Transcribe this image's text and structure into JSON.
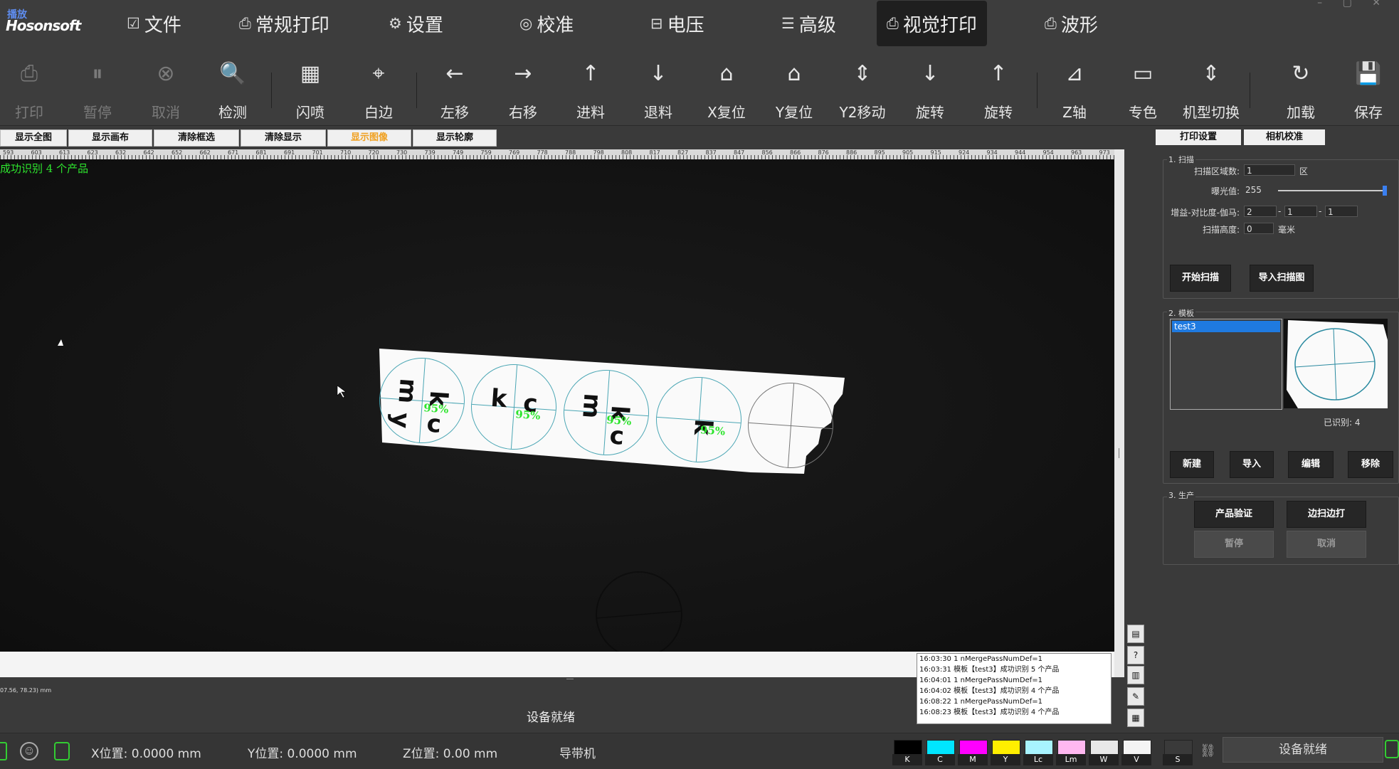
{
  "logo": {
    "top": "播放",
    "brand": "Hosonsoft"
  },
  "menu": [
    {
      "icon": "☑",
      "label": "文件"
    },
    {
      "icon": "⎙",
      "label": "常规打印"
    },
    {
      "icon": "⚙",
      "label": "设置"
    },
    {
      "icon": "◎",
      "label": "校准"
    },
    {
      "icon": "⊟",
      "label": "电压"
    },
    {
      "icon": "☰",
      "label": "高级"
    },
    {
      "icon": "⎙",
      "label": "视觉打印"
    },
    {
      "icon": "⎙",
      "label": "波形"
    }
  ],
  "toolbar": [
    {
      "label": "打印",
      "icon": "⎙",
      "disabled": true
    },
    {
      "label": "暂停",
      "icon": "⏸",
      "disabled": true
    },
    {
      "label": "取消",
      "icon": "⊗",
      "disabled": true
    },
    {
      "label": "检测",
      "icon": "🔍",
      "disabled": false
    },
    {
      "label": "闪喷",
      "icon": "▦",
      "disabled": false
    },
    {
      "label": "白边",
      "icon": "⌖",
      "disabled": false
    },
    {
      "label": "左移",
      "icon": "←",
      "disabled": false
    },
    {
      "label": "右移",
      "icon": "→",
      "disabled": false
    },
    {
      "label": "进料",
      "icon": "↑",
      "disabled": false
    },
    {
      "label": "退料",
      "icon": "↓",
      "disabled": false
    },
    {
      "label": "X复位",
      "icon": "⌂",
      "disabled": false
    },
    {
      "label": "Y复位",
      "icon": "⌂",
      "disabled": false
    },
    {
      "label": "Y2移动",
      "icon": "⇕",
      "disabled": false
    },
    {
      "label": "旋转",
      "icon": "↓",
      "disabled": false
    },
    {
      "label": "旋转",
      "icon": "↑",
      "disabled": false
    },
    {
      "label": "Z轴",
      "icon": "⊿",
      "disabled": false
    },
    {
      "label": "专色",
      "icon": "▭",
      "disabled": false
    },
    {
      "label": "机型切换",
      "icon": "⇕",
      "disabled": false
    },
    {
      "label": "加载",
      "icon": "↻",
      "disabled": false
    },
    {
      "label": "保存",
      "icon": "💾",
      "disabled": false
    }
  ],
  "view_buttons": [
    {
      "label": "显示全图",
      "active": false
    },
    {
      "label": "显示画布",
      "active": false
    },
    {
      "label": "清除框选",
      "active": false
    },
    {
      "label": "清除显示",
      "active": false
    },
    {
      "label": "显示图像",
      "active": true
    },
    {
      "label": "显示轮廓",
      "active": false
    }
  ],
  "ruler_labels": [
    "593",
    "603",
    "613",
    "623",
    "632",
    "642",
    "652",
    "662",
    "671",
    "681",
    "691",
    "701",
    "710",
    "720",
    "730",
    "739",
    "749",
    "759",
    "769",
    "778",
    "788",
    "798",
    "808",
    "817",
    "827",
    "837",
    "847",
    "856",
    "866",
    "876",
    "886",
    "895",
    "905",
    "915",
    "924",
    "934",
    "944",
    "954",
    "963",
    "973"
  ],
  "canvas": {
    "success_text": "成功识别 4 个产品",
    "products": [
      {
        "letters": [
          "m",
          "k",
          "y",
          "c"
        ],
        "percent": "95%"
      },
      {
        "letters": [
          "k",
          "c"
        ],
        "percent": "95%"
      },
      {
        "letters": [
          "m",
          "k",
          "c"
        ],
        "percent": "95%"
      },
      {
        "letters": [
          "k"
        ],
        "percent": "95%"
      },
      {
        "letters": [],
        "percent": ""
      }
    ],
    "coord_text": "07.56, 78.23) mm",
    "status": "设备就绪"
  },
  "right_panel": {
    "tabs": [
      "打印设置",
      "相机校准"
    ],
    "scan": {
      "group_title": "1. 扫描",
      "area_count_label": "扫描区域数:",
      "area_count_value": "1",
      "area_unit": "区",
      "exposure_label": "曝光值:",
      "exposure_value": "255",
      "exposure_level": 1.0,
      "gain_label": "增益-对比度-伽马:",
      "gain_value": "2",
      "contrast_value": "1",
      "gamma_value": "1",
      "height_label": "扫描高度:",
      "height_value": "0",
      "height_unit": "毫米",
      "start_scan": "开始扫描",
      "import_scan": "导入扫描图"
    },
    "template": {
      "group_title": "2. 模板",
      "list": [
        "test3"
      ],
      "recognized_label": "已识别:",
      "recognized_value": "4",
      "buttons": [
        "新建",
        "导入",
        "编辑",
        "移除"
      ]
    },
    "production": {
      "group_title": "3. 生产",
      "verify": "产品验证",
      "scan_print": "边扫边打",
      "pause": "暂停",
      "cancel": "取消"
    }
  },
  "log": [
    "16:03:30  1 nMergePassNumDef=1",
    "16:03:31  模板【test3】成功识别 5 个产品",
    "16:04:01  1 nMergePassNumDef=1",
    "16:04:02  模板【test3】成功识别 4 个产品",
    "16:08:22  1 nMergePassNumDef=1",
    "16:08:23  模板【test3】成功识别 4 个产品"
  ],
  "status_bar": {
    "x_label": "X位置: 0.0000 mm",
    "y_label": "Y位置: 0.0000 mm",
    "z_label": "Z位置: 0.00 mm",
    "mode": "导带机",
    "ready": "设备就绪"
  },
  "inks": [
    {
      "name": "K",
      "color": "#000000"
    },
    {
      "name": "C",
      "color": "#00e5ff"
    },
    {
      "name": "M",
      "color": "#ff00ff"
    },
    {
      "name": "Y",
      "color": "#ffee00"
    },
    {
      "name": "Lc",
      "color": "#a8f4ff"
    },
    {
      "name": "Lm",
      "color": "#ffb8f0"
    },
    {
      "name": "W",
      "color": "#e8e8e8"
    },
    {
      "name": "V",
      "color": "#f4f4f4"
    },
    {
      "name": "S",
      "color": "#3a3a3a"
    }
  ]
}
